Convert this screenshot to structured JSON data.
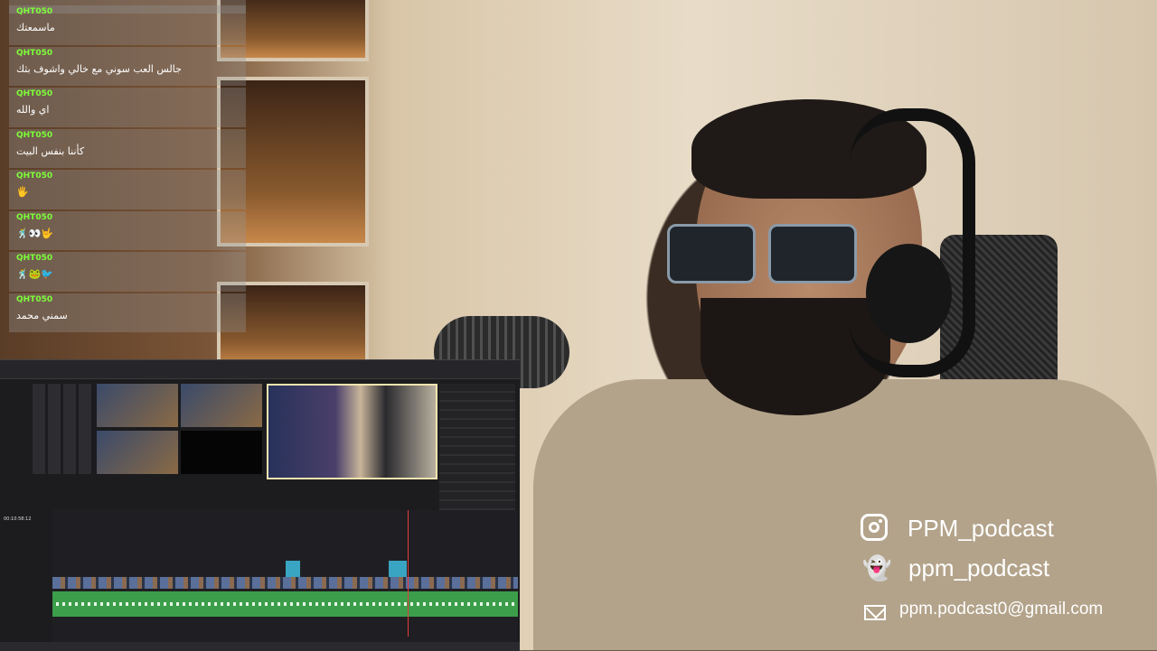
{
  "chat": {
    "messages": [
      {
        "user": "QHT050",
        "text": "ماسمعتك"
      },
      {
        "user": "QHT050",
        "text": "جالس العب سوني مع خالي واشوف بثك"
      },
      {
        "user": "QHT050",
        "text": "اي والله"
      },
      {
        "user": "QHT050",
        "text": "كأننا بنفس البيت"
      },
      {
        "user": "QHT050",
        "text": "🖐"
      },
      {
        "user": "QHT050",
        "text": "🕺👀🤟"
      },
      {
        "user": "QHT050",
        "text": "🕺🐸🐦"
      },
      {
        "user": "QHT050",
        "text": "سمني محمد"
      }
    ]
  },
  "editor": {
    "timecode": "00:10:58:12"
  },
  "social": {
    "instagram": "PPM_podcast",
    "snapchat": "ppm_podcast",
    "email": "ppm.podcast0@gmail.com"
  },
  "colors": {
    "chat_username": "#7dff3a",
    "audio_track": "#3c9e4a",
    "video_clip_marker": "#3aa5c2",
    "playhead": "#e23b3b"
  },
  "icons": [
    "instagram-icon",
    "snapchat-icon",
    "email-icon"
  ]
}
